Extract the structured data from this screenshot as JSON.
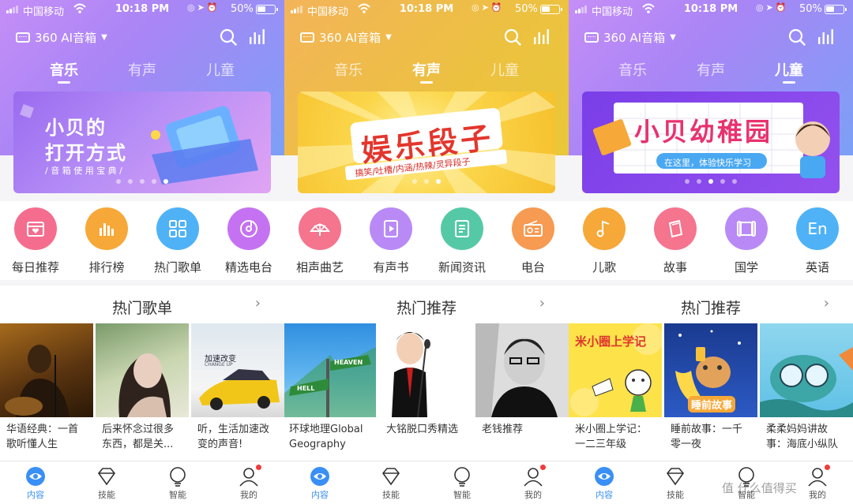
{
  "status_bar": {
    "carrier": "中国移动",
    "time": "10:18 PM",
    "battery": "50%"
  },
  "device_label": "360 AI音箱",
  "tabs": [
    "音乐",
    "有声",
    "儿童"
  ],
  "screens": [
    {
      "active_tab": 0,
      "banner": {
        "title1": "小贝的",
        "title2": "打开方式",
        "sub": "/ 音 箱 使 用 宝 典 /",
        "dots": 5,
        "active_dot": 4
      },
      "categories": [
        {
          "label": "每日推荐",
          "color": "#f56d8e",
          "icon": "calendar-heart-icon"
        },
        {
          "label": "排行榜",
          "color": "#f6a838",
          "icon": "bar-chart-icon"
        },
        {
          "label": "热门歌单",
          "color": "#4fb2f7",
          "icon": "grid-icon"
        },
        {
          "label": "精选电台",
          "color": "#c572f2",
          "icon": "disc-icon"
        }
      ],
      "section_title": "热门歌单",
      "cards": [
        {
          "title": "华语经典：一首歌听懂人生"
        },
        {
          "title": "后来怀念过很多东西，都是关..."
        },
        {
          "title": "听，生活加速改变的声音!",
          "img_text": "加速改变",
          "img_sub": "CHANGE UP"
        },
        {
          "title": "环球地理Global Geography",
          "img_sign1": "HEAVEN",
          "img_sign2": "HELL"
        }
      ]
    },
    {
      "active_tab": 1,
      "banner": {
        "title1": "娱乐段子",
        "sub": "搞笑/吐槽/内涵/热辣/灵异段子",
        "dots": 3,
        "active_dot": 2
      },
      "categories": [
        {
          "label": "相声曲艺",
          "color": "#f5748e",
          "icon": "fan-icon"
        },
        {
          "label": "有声书",
          "color": "#b98af6",
          "icon": "book-play-icon"
        },
        {
          "label": "新闻资讯",
          "color": "#55c9a6",
          "icon": "news-icon"
        },
        {
          "label": "电台",
          "color": "#f79a52",
          "icon": "radio-icon"
        }
      ],
      "section_title": "热门推荐",
      "cards": [
        {
          "title": "大铭脱口秀精选"
        },
        {
          "title": "老钱推荐"
        }
      ]
    },
    {
      "active_tab": 2,
      "banner": {
        "title1": "小贝幼稚园",
        "sub": "在这里，体验快乐学习",
        "dots": 5,
        "active_dot": 2
      },
      "categories": [
        {
          "label": "儿歌",
          "color": "#f6a838",
          "icon": "music-note-icon"
        },
        {
          "label": "故事",
          "color": "#f5748e",
          "icon": "story-book-icon"
        },
        {
          "label": "国学",
          "color": "#b98af6",
          "icon": "scroll-icon"
        },
        {
          "label": "英语",
          "color": "#4fb2f7",
          "icon": "english-icon",
          "glyph": "En"
        }
      ],
      "section_title": "热门推荐",
      "cards": [
        {
          "title": "米小圈上学记：一二三年级",
          "img_text": "米小圈上学记"
        },
        {
          "title": "睡前故事：一千零一夜",
          "img_text": "睡前故事"
        },
        {
          "title": "柔柔妈妈讲故事：海底小纵队"
        }
      ]
    }
  ],
  "nav": [
    {
      "label": "内容",
      "icon": "content-eye-icon"
    },
    {
      "label": "技能",
      "icon": "skill-diamond-icon"
    },
    {
      "label": "智能",
      "icon": "smart-bulb-icon"
    },
    {
      "label": "我的",
      "icon": "profile-icon"
    }
  ],
  "watermark": "值 什么值得买",
  "colors": {
    "nav_active": "#3a8ff5",
    "music_header": "#a985f5",
    "audio_header": "#ecc140",
    "badge": "#f23b3b"
  }
}
